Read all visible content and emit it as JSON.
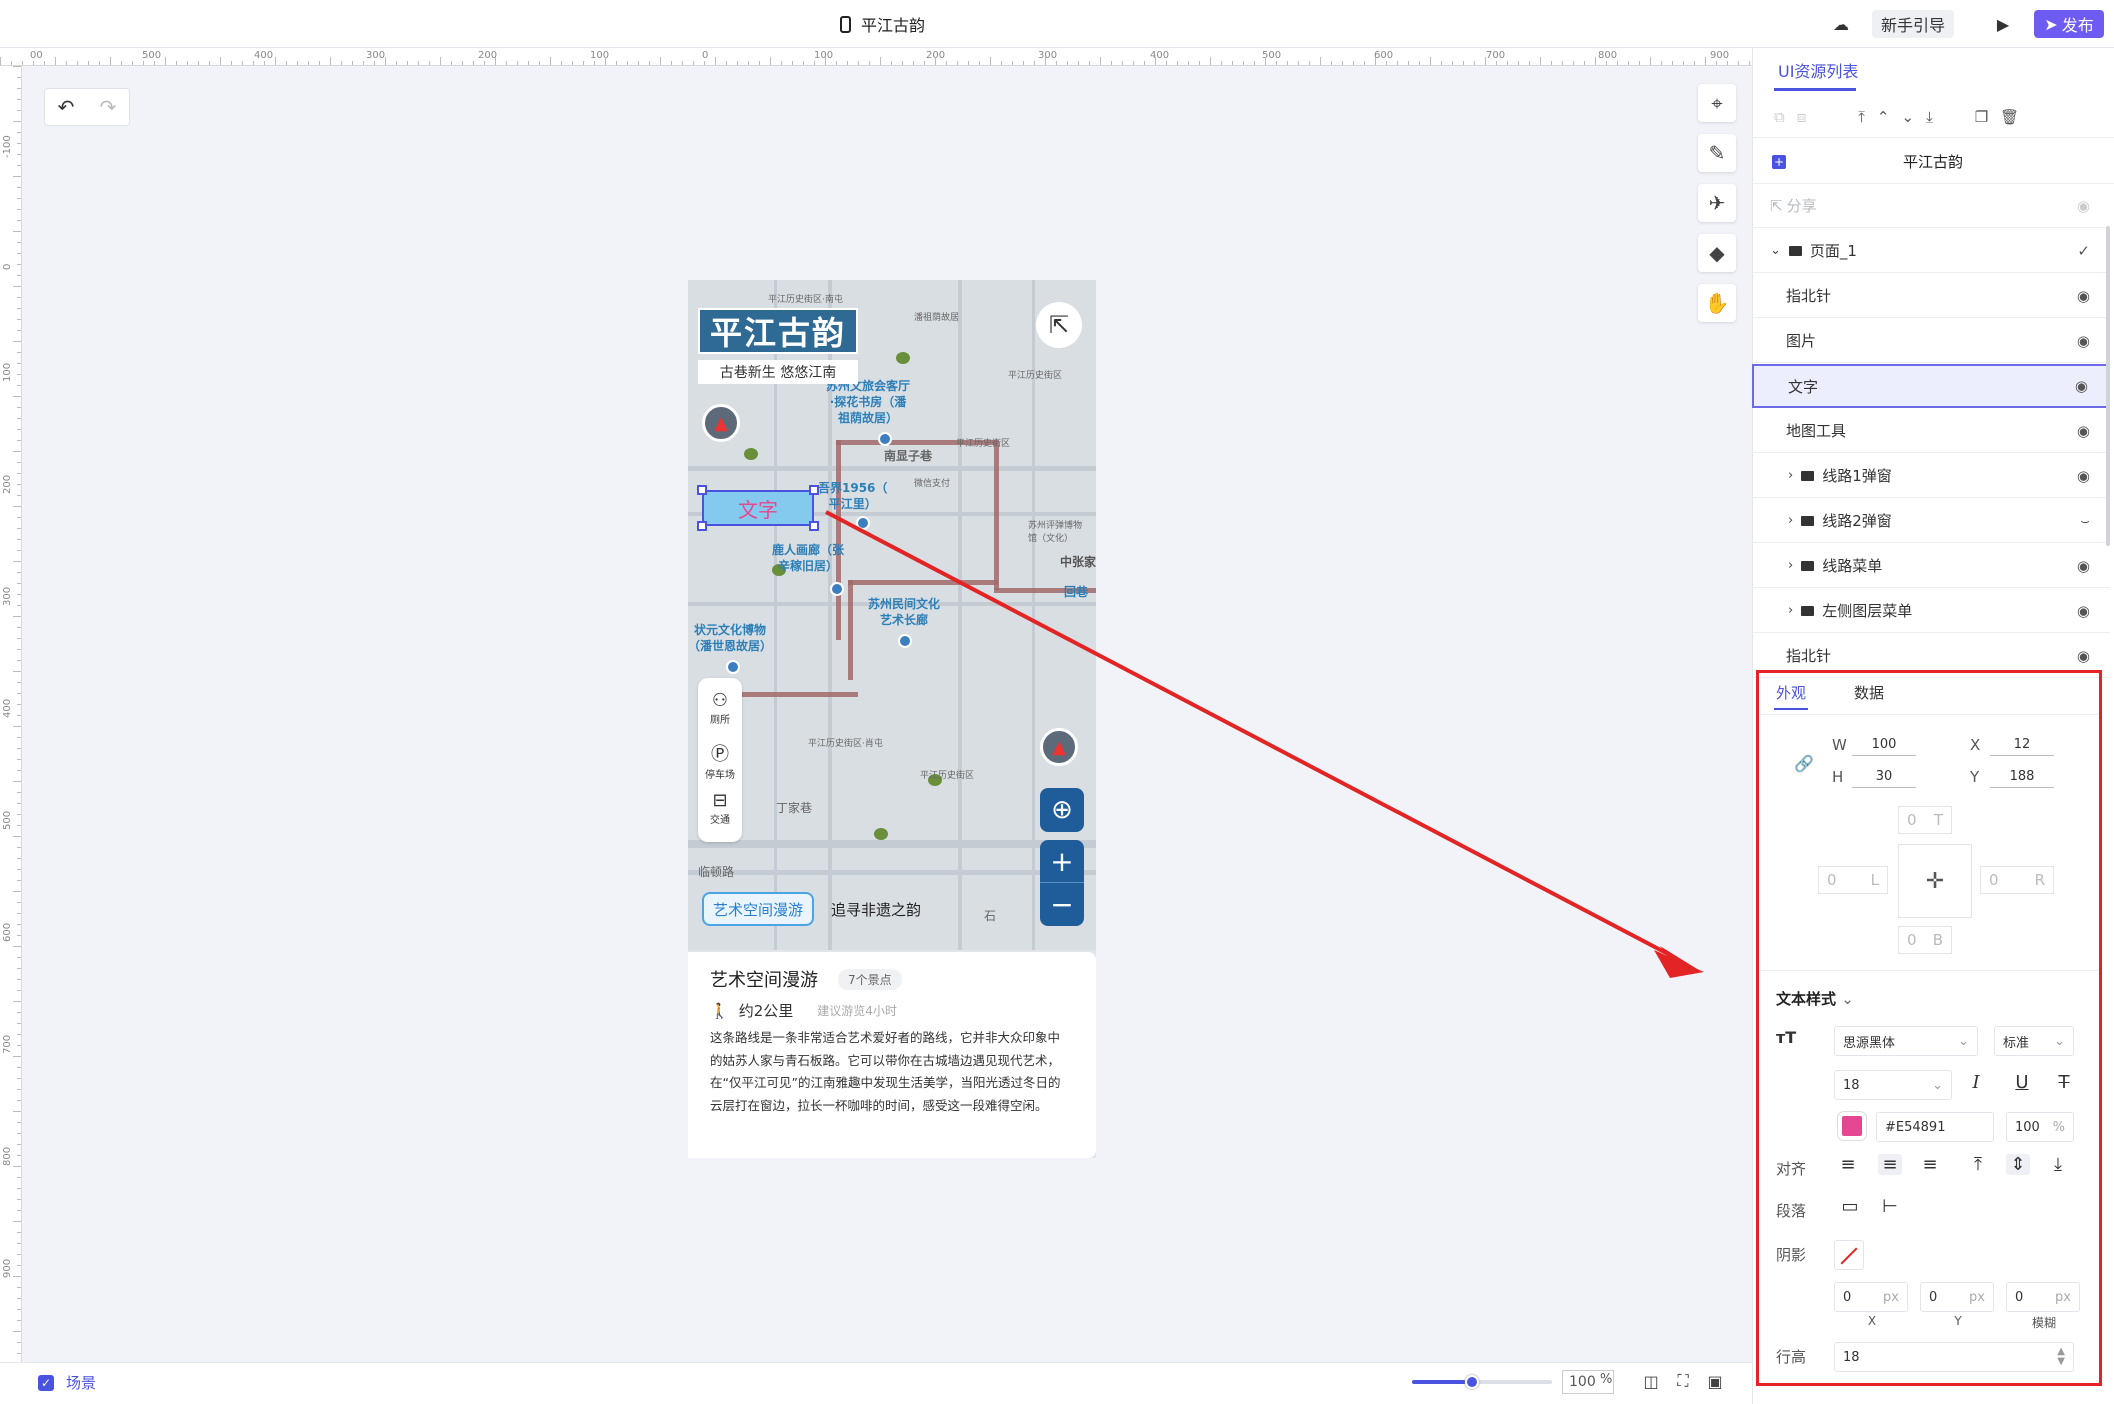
{
  "topbar": {
    "doc_title": "平江古韵",
    "guide_label": "新手引导",
    "publish_label": "发布"
  },
  "rulers": {
    "top": [
      "00",
      "500",
      "400",
      "300",
      "200",
      "100",
      "0",
      "100",
      "200",
      "300",
      "400",
      "500",
      "600",
      "700",
      "800",
      "900"
    ],
    "left": [
      "-100",
      "0",
      "100",
      "200",
      "300",
      "400",
      "500",
      "600",
      "700",
      "800",
      "900"
    ]
  },
  "phone": {
    "brand_title": "平江古韵",
    "brand_subtitle": "古巷新生  悠悠江南",
    "text_element": "文字",
    "pois": [
      "苏州文旅会客厅\n·探花书房（潘\n祖荫故居）",
      "南显子巷",
      "吾界1956（\n平江里）",
      "鹿人画廊（张\n辛稼旧居）",
      "苏州民间文化\n艺术长廊",
      "状元文化博物\n（潘世恩故居）",
      "中张家",
      "回巷",
      "临顿路",
      "丁家巷",
      "石"
    ],
    "small_labels": [
      "平江历史街区·南屯",
      "平江历史街区",
      "平江历史街区",
      "平江历史街区",
      "苏州评弹博物馆（文化）",
      "平江历史街区·肖屯",
      "微信支付",
      "潘祖荫故居"
    ],
    "side_tools": [
      {
        "icon": "restroom-icon",
        "label": "厕所"
      },
      {
        "icon": "parking-icon",
        "label": "停车场"
      },
      {
        "icon": "transit-icon",
        "label": "交通"
      }
    ],
    "route_tabs": [
      "艺术空间漫游",
      "追寻非遗之韵"
    ],
    "card": {
      "title": "艺术空间漫游",
      "badge": "7个景点",
      "distance": "约2公里",
      "duration": "建议游览4小时",
      "description": "这条路线是一条非常适合艺术爱好者的路线，它并非大众印象中的姑苏人家与青石板路。它可以带你在古城墙边遇见现代艺术，在“仅平江可见”的江南雅趣中发现生活美学，当阳光透过冬日的云层打在窗边，拉长一杯咖啡的时间，感受这一段难得空闲。"
    }
  },
  "bottombar": {
    "scene_label": "场景",
    "zoom_value": "100",
    "zoom_unit": "%",
    "zoom_fraction": 0.43
  },
  "panel": {
    "tab": "UI资源列表",
    "root": "平江古韵",
    "layers": [
      {
        "label": "分享",
        "dim": true,
        "level": 0,
        "eye": "visible"
      },
      {
        "label": "页面_1",
        "level": 0,
        "folder": true,
        "expanded": true,
        "eye": "check"
      },
      {
        "label": "指北针",
        "level": 1,
        "eye": "visible"
      },
      {
        "label": "图片",
        "level": 1,
        "eye": "visible"
      },
      {
        "label": "文字",
        "level": 1,
        "eye": "visible",
        "selected": true
      },
      {
        "label": "地图工具",
        "level": 1,
        "eye": "visible"
      },
      {
        "label": "线路1弹窗",
        "level": 1,
        "folder": true,
        "eye": "visible"
      },
      {
        "label": "线路2弹窗",
        "level": 1,
        "folder": true,
        "eye": "hidden"
      },
      {
        "label": "线路菜单",
        "level": 1,
        "folder": true,
        "eye": "visible"
      },
      {
        "label": "左侧图层菜单",
        "level": 1,
        "folder": true,
        "eye": "visible"
      },
      {
        "label": "指北针",
        "level": 1,
        "eye": "visible"
      }
    ]
  },
  "props": {
    "tab_look": "外观",
    "tab_data": "数据",
    "w_label": "W",
    "w": "100",
    "h_label": "H",
    "h": "30",
    "x_label": "X",
    "x": "12",
    "y_label": "Y",
    "y": "188",
    "margin": {
      "t": "0",
      "t_label": "T",
      "l": "0",
      "l_label": "L",
      "r": "0",
      "r_label": "R",
      "b": "0",
      "b_label": "B"
    },
    "text_style_label": "文本样式",
    "font_family": "思源黑体",
    "font_weight": "标准",
    "font_size": "18",
    "color_hex": "#E54891",
    "color": "#e54891",
    "opacity": "100",
    "opacity_unit": "%",
    "align_label": "对齐",
    "paragraph_label": "段落",
    "shadow_label": "阴影",
    "shadow": {
      "x": "0",
      "y": "0",
      "blur": "0",
      "unit": "px",
      "x_label": "X",
      "y_label": "Y",
      "blur_label": "模糊"
    },
    "line_height_label": "行高",
    "line_height": "18"
  },
  "annotation": {
    "arrow_color": "#e32424"
  }
}
